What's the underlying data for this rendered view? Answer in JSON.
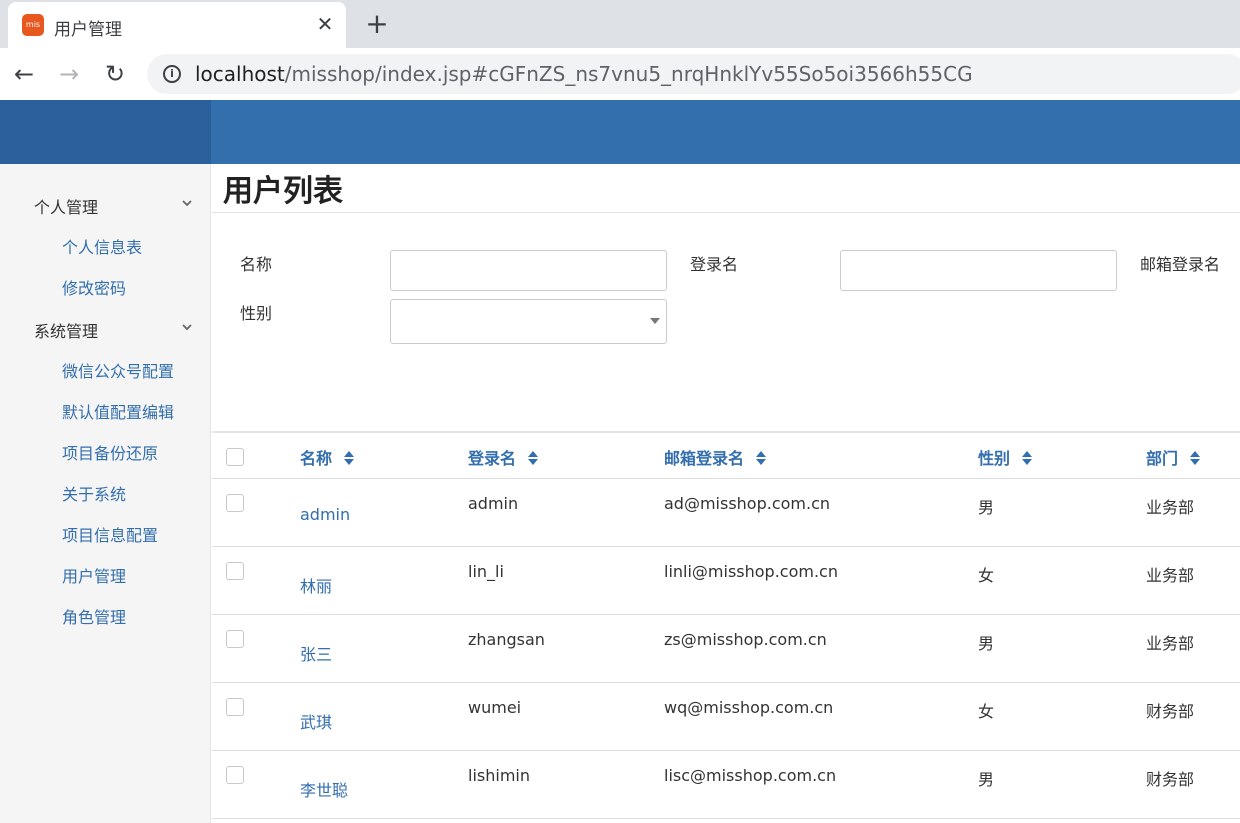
{
  "browser": {
    "tab_title": "用户管理",
    "favicon_text": "mis",
    "url_host": "localhost",
    "url_path": "/misshop/index.jsp#cGFnZS_ns7vnu5_nrqHnklYv55So5oi3566h55CG"
  },
  "colors": {
    "header": "#336ead",
    "link": "#336ead"
  },
  "sidebar": {
    "groups": [
      {
        "label": "个人管理",
        "items": [
          "个人信息表",
          "修改密码"
        ]
      },
      {
        "label": "系统管理",
        "items": [
          "微信公众号配置",
          "默认值配置编辑",
          "项目备份还原",
          "关于系统",
          "项目信息配置",
          "用户管理",
          "角色管理"
        ]
      }
    ]
  },
  "page": {
    "title": "用户列表"
  },
  "filters": {
    "name_label": "名称",
    "name_value": "",
    "login_label": "登录名",
    "login_value": "",
    "email_label": "邮箱登录名",
    "gender_label": "性别",
    "gender_value": ""
  },
  "table": {
    "columns": [
      "名称",
      "登录名",
      "邮箱登录名",
      "性别",
      "部门"
    ],
    "rows": [
      {
        "name": "admin",
        "login": "admin",
        "email": "ad@misshop.com.cn",
        "gender": "男",
        "dept": "业务部"
      },
      {
        "name": "林丽",
        "login": "lin_li",
        "email": "linli@misshop.com.cn",
        "gender": "女",
        "dept": "业务部"
      },
      {
        "name": "张三",
        "login": "zhangsan",
        "email": "zs@misshop.com.cn",
        "gender": "男",
        "dept": "业务部"
      },
      {
        "name": "武琪",
        "login": "wumei",
        "email": "wq@misshop.com.cn",
        "gender": "女",
        "dept": "财务部"
      },
      {
        "name": "李世聪",
        "login": "lishimin",
        "email": "lisc@misshop.com.cn",
        "gender": "男",
        "dept": "财务部"
      }
    ]
  }
}
